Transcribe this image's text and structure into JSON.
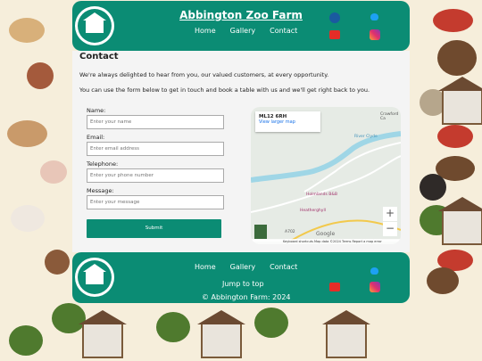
{
  "header": {
    "title": "Abbington Zoo Farm",
    "nav": [
      "Home",
      "Gallery",
      "Contact"
    ]
  },
  "social": {
    "icons": [
      "facebook-icon",
      "twitter-icon",
      "youtube-icon",
      "instagram-icon"
    ]
  },
  "main": {
    "heading": "Contact",
    "intro1": "We're always delighted to hear from you, our valued customers, at every opportunity.",
    "intro2": "You can use the form below to get in touch and book a table with us and we'll get right back to you.",
    "form": {
      "name_label": "Name:",
      "name_placeholder": "Enter your name",
      "email_label": "Email:",
      "email_placeholder": "Enter email address",
      "phone_label": "Telephone:",
      "phone_placeholder": "Enter your phone number",
      "message_label": "Message:",
      "message_placeholder": "Enter your message",
      "submit": "Submit"
    }
  },
  "map": {
    "postcode": "ML12 6RH",
    "view_larger": "View larger map",
    "place1": "Holmlands B&B",
    "place2": "Heatherghyll",
    "river": "River Clyde",
    "road": "A702",
    "road2": "Crawford Ca",
    "brand": "Google",
    "footer": "Keyboard shortcuts   Map data ©2024   Terms   Report a map error",
    "zoom_in": "+",
    "zoom_out": "−"
  },
  "footer": {
    "nav": [
      "Home",
      "Gallery",
      "Contact"
    ],
    "jump": "Jump to top",
    "copyright": "© Abbington Farm: 2024"
  },
  "colors": {
    "brand": "#0b8c74",
    "youtube": "#e52d27",
    "twitter": "#1da1f2",
    "facebook": "#1877f2"
  }
}
